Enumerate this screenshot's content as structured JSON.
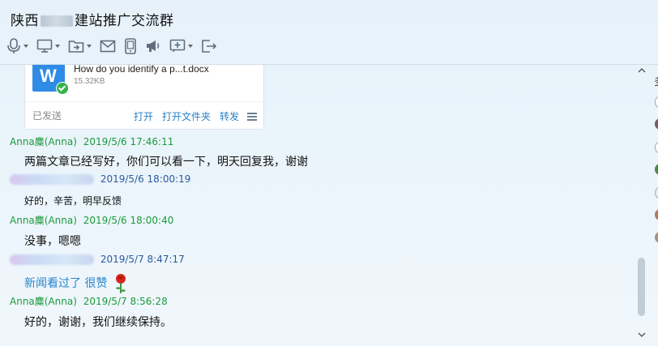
{
  "window": {
    "title_prefix": "陕西",
    "title_suffix": "建站推广交流群"
  },
  "toolbar": {
    "items": [
      {
        "icon": "microphone-icon",
        "dropdown": true
      },
      {
        "icon": "monitor-icon",
        "dropdown": true
      },
      {
        "icon": "file-transfer-icon",
        "dropdown": true
      },
      {
        "icon": "mail-icon",
        "dropdown": false
      },
      {
        "icon": "phone-icon",
        "dropdown": false
      },
      {
        "icon": "megaphone-icon",
        "dropdown": false
      },
      {
        "icon": "add-app-icon",
        "dropdown": true
      },
      {
        "icon": "exit-icon",
        "dropdown": false
      }
    ]
  },
  "file_card": {
    "file_name": "How do you identify a p...t.docx",
    "file_size": "15.32KB",
    "status": "已发送",
    "actions": [
      "打开",
      "打开文件夹",
      "转发"
    ]
  },
  "messages": [
    {
      "sender": "Anna麋",
      "sender_alias": "(Anna)",
      "time": "2019/5/6 17:46:11",
      "text": "两篇文章已经写好，你们可以看一下，明天回复我，谢谢"
    },
    {
      "sender": "",
      "time": "2019/5/6 18:00:19",
      "text": "好的，辛苦，明早反馈"
    },
    {
      "sender": "Anna麋",
      "sender_alias": "(Anna)",
      "time": "2019/5/6 18:00:40",
      "text": "没事，嗯嗯"
    },
    {
      "sender": "",
      "time": "2019/5/7 8:47:17",
      "text": "新闻看过了 很赞"
    },
    {
      "sender": "Anna麋",
      "sender_alias": "(Anna)",
      "time": "2019/5/7 8:56:28",
      "text": "好的，谢谢，我们继续保持。"
    }
  ],
  "side_panel": {
    "label": "多"
  },
  "colors": {
    "self_name": "#1d9a3c",
    "other_time": "#2c5aa0",
    "link": "#2a7fc4",
    "word_icon": "#2f8be6"
  }
}
